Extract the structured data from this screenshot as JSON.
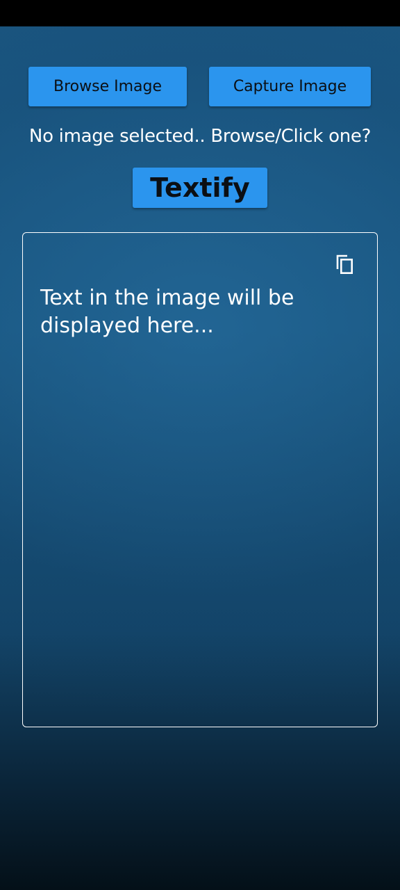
{
  "buttons": {
    "browse_label": "Browse Image",
    "capture_label": "Capture Image",
    "textify_label": "Textify"
  },
  "status": {
    "message": "No image selected.. Browse/Click one?"
  },
  "output": {
    "placeholder": "Text in the image will be displayed here...",
    "copy_icon": "copy-icon"
  },
  "colors": {
    "button_bg": "#2b95ee",
    "background": "#1a5580",
    "text": "#ffffff"
  }
}
